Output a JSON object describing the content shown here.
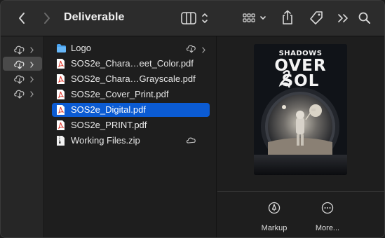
{
  "window": {
    "title": "Deliverable"
  },
  "toolbar": {
    "back_icon": "chevron-left-icon",
    "forward_icon": "chevron-right-icon",
    "view_icon": "column-view-icon",
    "group_icon": "group-grid-icon",
    "share_icon": "share-icon",
    "tag_icon": "tag-icon",
    "more_icon": "double-chevron-icon",
    "search_icon": "search-icon"
  },
  "sidebar_column": {
    "rows": [
      {
        "icon": "cloud-download-icon",
        "selected": false
      },
      {
        "icon": "cloud-download-icon",
        "selected": true
      },
      {
        "icon": "cloud-download-icon",
        "selected": false
      },
      {
        "icon": "cloud-download-icon",
        "selected": false
      }
    ]
  },
  "files": [
    {
      "name": "Logo",
      "kind": "folder",
      "cloud": true,
      "chevron": true,
      "selected": false
    },
    {
      "name": "SOS2e_Chara…eet_Color.pdf",
      "kind": "pdf",
      "cloud": false,
      "selected": false
    },
    {
      "name": "SOS2e_Chara…Grayscale.pdf",
      "kind": "pdf",
      "cloud": false,
      "selected": false
    },
    {
      "name": "SOS2e_Cover_Print.pdf",
      "kind": "pdf",
      "cloud": false,
      "selected": false
    },
    {
      "name": "SOS2e_Digital.pdf",
      "kind": "pdf",
      "cloud": false,
      "selected": true
    },
    {
      "name": "SOS2e_PRINT.pdf",
      "kind": "pdf",
      "cloud": false,
      "selected": false
    },
    {
      "name": "Working Files.zip",
      "kind": "zip",
      "cloud": true,
      "selected": false
    }
  ],
  "preview": {
    "cover_line1": "SHADOWS",
    "cover_line2": "OVER",
    "cover_line3": "SOL",
    "actions": [
      {
        "label": "Markup",
        "icon": "markup-icon"
      },
      {
        "label": "More...",
        "icon": "more-icon"
      }
    ]
  },
  "colors": {
    "selection": "#0b5bd3",
    "pdf_red": "#e03a2e",
    "folder_blue": "#4aa3f0"
  }
}
